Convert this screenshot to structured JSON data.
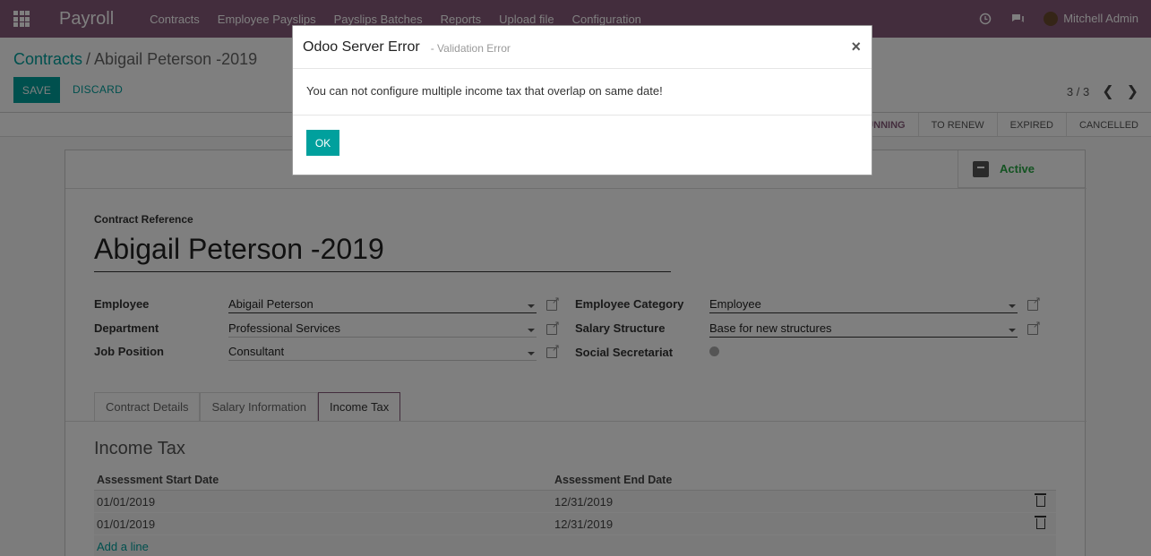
{
  "navbar": {
    "app_name": "Payroll",
    "menu": [
      "Contracts",
      "Employee Payslips",
      "Payslips Batches",
      "Reports",
      "Upload file",
      "Configuration"
    ],
    "user": "Mitchell Admin"
  },
  "control": {
    "breadcrumb_parent": "Contracts",
    "breadcrumb_sep": "/",
    "breadcrumb_current": "Abigail Peterson -2019",
    "save_label": "SAVE",
    "discard_label": "DISCARD",
    "pager": "3 / 3"
  },
  "statusbar": {
    "stages": [
      "RUNNING",
      "TO RENEW",
      "EXPIRED",
      "CANCELLED"
    ],
    "current": "RUNNING"
  },
  "sheet": {
    "active_label": "Active",
    "ref_label": "Contract Reference",
    "title": "Abigail Peterson -2019",
    "fields": {
      "employee_label": "Employee",
      "employee_value": "Abigail Peterson",
      "department_label": "Department",
      "department_value": "Professional Services",
      "job_label": "Job Position",
      "job_value": "Consultant",
      "category_label": "Employee Category",
      "category_value": "Employee",
      "structure_label": "Salary Structure",
      "structure_value": "Base for new structures",
      "secretariat_label": "Social Secretariat"
    },
    "tabs": [
      "Contract Details",
      "Salary Information",
      "Income Tax"
    ],
    "active_tab": "Income Tax",
    "section_title": "Income Tax",
    "table": {
      "headers": [
        "Assessment Start Date",
        "Assessment End Date"
      ],
      "rows": [
        [
          "01/01/2019",
          "12/31/2019"
        ],
        [
          "01/01/2019",
          "12/31/2019"
        ]
      ],
      "add_line": "Add a line"
    }
  },
  "modal": {
    "title": "Odoo Server Error",
    "subtitle": "- Validation Error",
    "close": "×",
    "message": "You can not configure multiple income tax that overlap on same date!",
    "ok_label": "OK"
  },
  "colors": {
    "brand": "#875a7b",
    "accent": "#00a09d",
    "active_green": "#28a745"
  }
}
